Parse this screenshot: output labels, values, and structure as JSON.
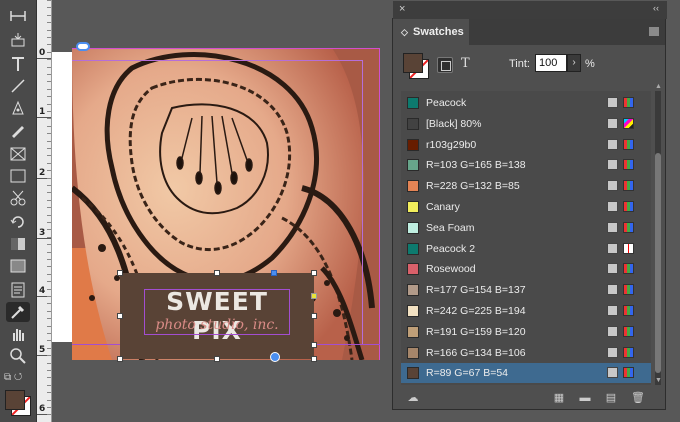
{
  "toolbar": {
    "tools": [
      {
        "name": "gap-tool-icon"
      },
      {
        "name": "content-collector-icon"
      },
      {
        "name": "type-tool-icon"
      },
      {
        "name": "line-tool-icon"
      },
      {
        "name": "pen-tool-icon"
      },
      {
        "name": "pencil-tool-icon"
      },
      {
        "name": "rectangle-frame-tool-icon"
      },
      {
        "name": "rectangle-tool-icon"
      },
      {
        "name": "scissors-tool-icon"
      },
      {
        "name": "free-transform-tool-icon"
      },
      {
        "name": "gradient-swatch-tool-icon"
      },
      {
        "name": "gradient-feather-tool-icon"
      },
      {
        "name": "note-tool-icon"
      },
      {
        "name": "eyedropper-tool-icon"
      },
      {
        "name": "hand-tool-icon"
      },
      {
        "name": "zoom-tool-icon"
      }
    ]
  },
  "ruler": {
    "numbers": [
      "0",
      "1",
      "2",
      "3",
      "4",
      "5",
      "6"
    ]
  },
  "logo": {
    "title": "SWEET PIX",
    "subtitle": "photo studio, inc."
  },
  "panel": {
    "title": "Swatches",
    "close": "×",
    "collapse": "‹‹",
    "tint_label": "Tint:",
    "tint_value": "100",
    "tint_unit": "%",
    "fill_color": "#594336"
  },
  "swatches": [
    {
      "name": "Peacock",
      "color": "#0d7a6e",
      "type": "rgb"
    },
    {
      "name": "[Black] 80%",
      "color": "#424242",
      "type": "cmyk"
    },
    {
      "name": "r103g29b0",
      "color": "#671d00",
      "type": "rgb"
    },
    {
      "name": "R=103 G=165 B=138",
      "color": "#67a58a",
      "type": "rgb"
    },
    {
      "name": "R=228 G=132 B=85",
      "color": "#e48455",
      "type": "rgb"
    },
    {
      "name": "Canary",
      "color": "#f2ee5c",
      "type": "rgb"
    },
    {
      "name": "Sea Foam",
      "color": "#bfeee0",
      "type": "rgb"
    },
    {
      "name": "Peacock 2",
      "color": "#0d7a6e",
      "type": "spot"
    },
    {
      "name": "Rosewood",
      "color": "#d9606a",
      "type": "rgb"
    },
    {
      "name": "R=177 G=154 B=137",
      "color": "#b19a89",
      "type": "rgb"
    },
    {
      "name": "R=242 G=225 B=194",
      "color": "#f2e1c2",
      "type": "rgb"
    },
    {
      "name": "R=191 G=159 B=120",
      "color": "#bf9f78",
      "type": "rgb"
    },
    {
      "name": "R=166 G=134 B=106",
      "color": "#a6866a",
      "type": "rgb"
    },
    {
      "name": "R=89 G=67 B=54",
      "color": "#594336",
      "type": "rgb",
      "selected": true
    }
  ]
}
